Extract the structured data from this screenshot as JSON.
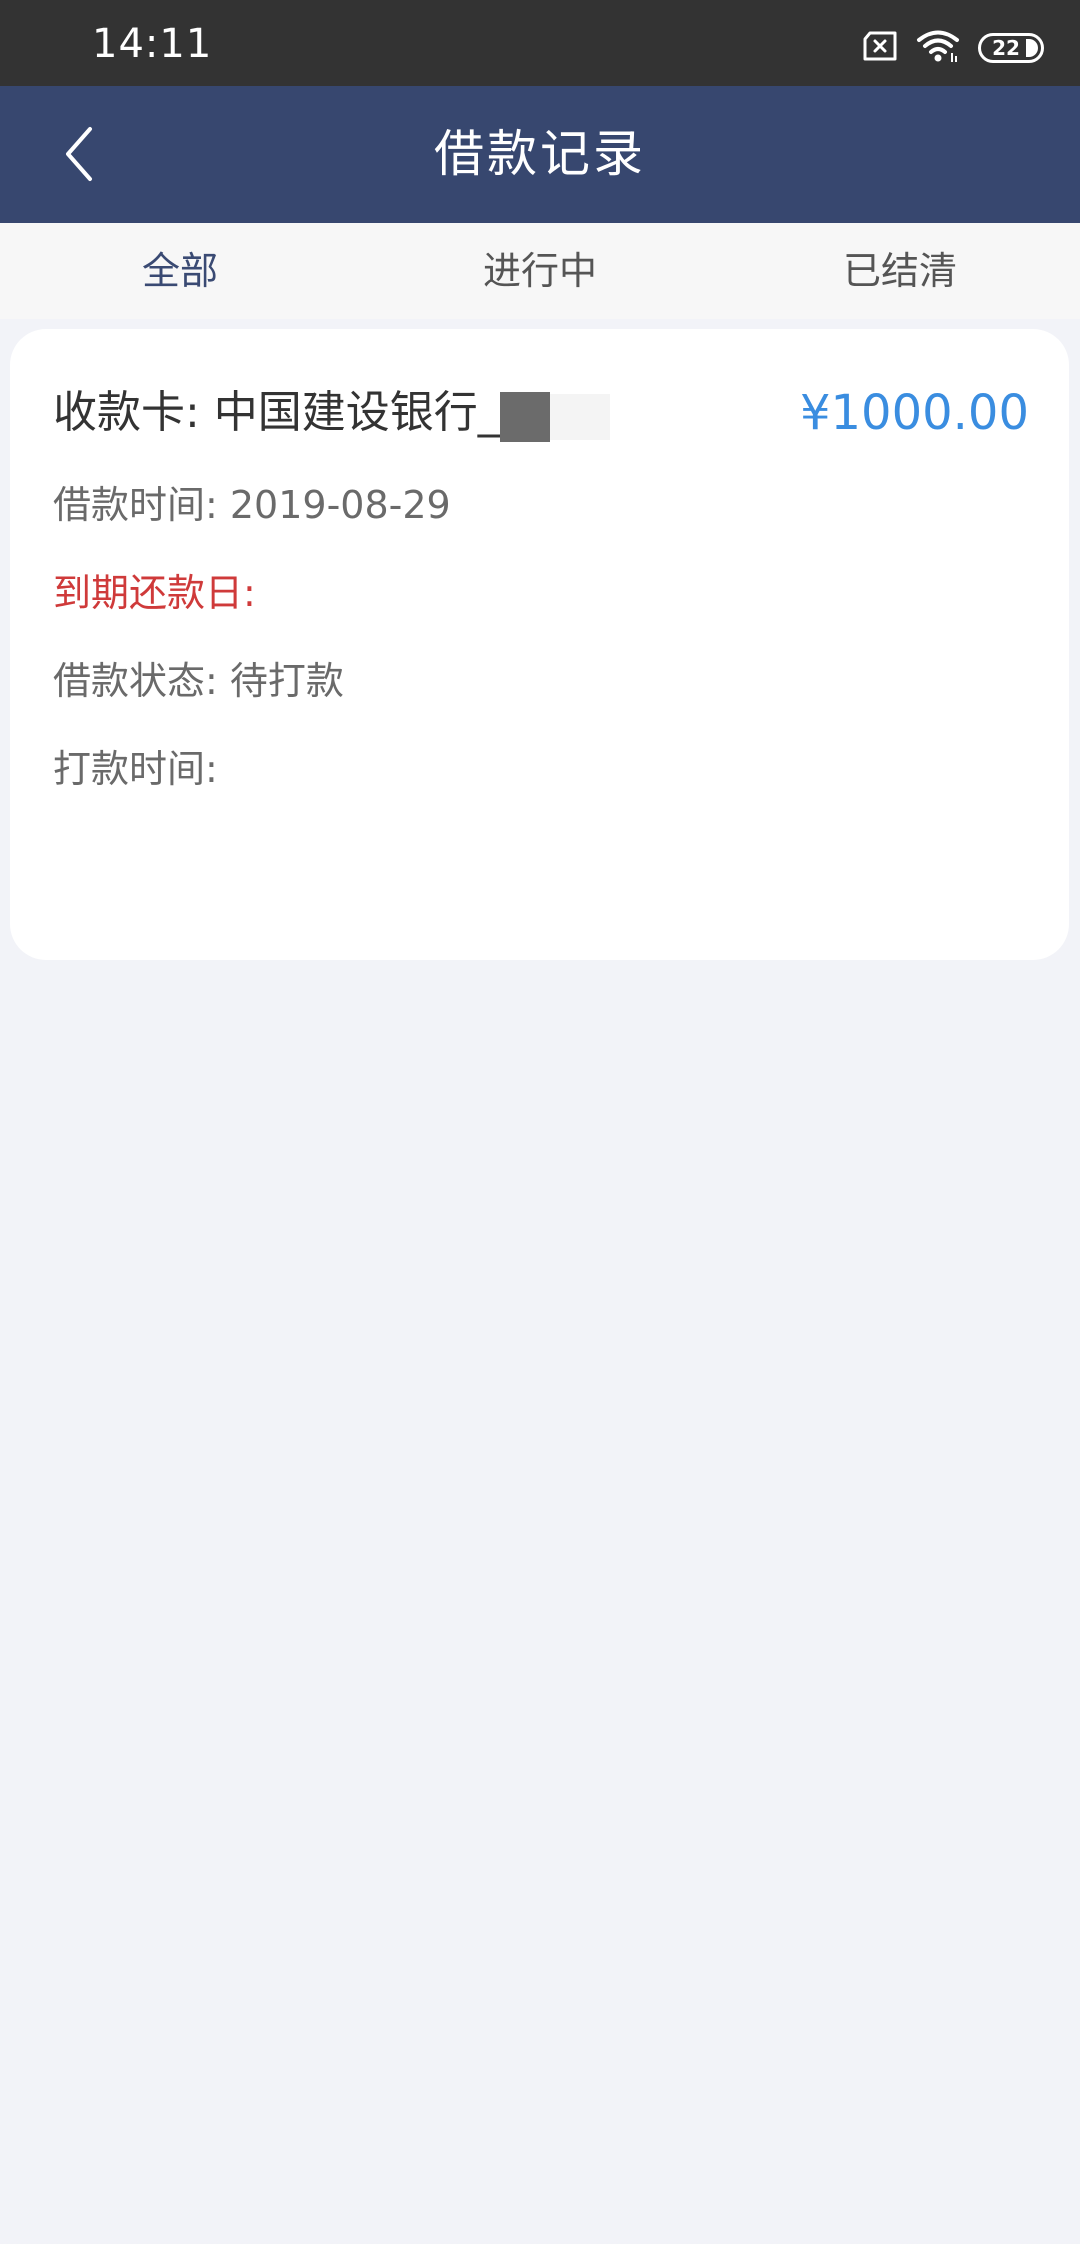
{
  "status_bar": {
    "time": "14:11",
    "icons": [
      "sim-error-icon",
      "wifi-icon",
      "battery-icon"
    ],
    "battery_level": "22"
  },
  "nav": {
    "title": "借款记录",
    "back_icon": "chevron-left-icon"
  },
  "tabs": [
    {
      "label": "全部",
      "active": true
    },
    {
      "label": "进行中",
      "active": false
    },
    {
      "label": "已结清",
      "active": false
    }
  ],
  "record": {
    "bank_card": "收款卡: 中国建设银行_4",
    "amount": "¥1000.00",
    "loan_time": "借款时间: 2019-08-29",
    "due_date": "到期还款日:",
    "status": "借款状态: 待打款",
    "pay_time": "打款时间:"
  },
  "colors": {
    "status_bar": "#333333",
    "nav_bar": "#37476f",
    "page_bg": "#f2f3f8",
    "amount": "#3a8de0",
    "due_date": "#cf3a3a",
    "active_tab": "#3a4a73"
  }
}
